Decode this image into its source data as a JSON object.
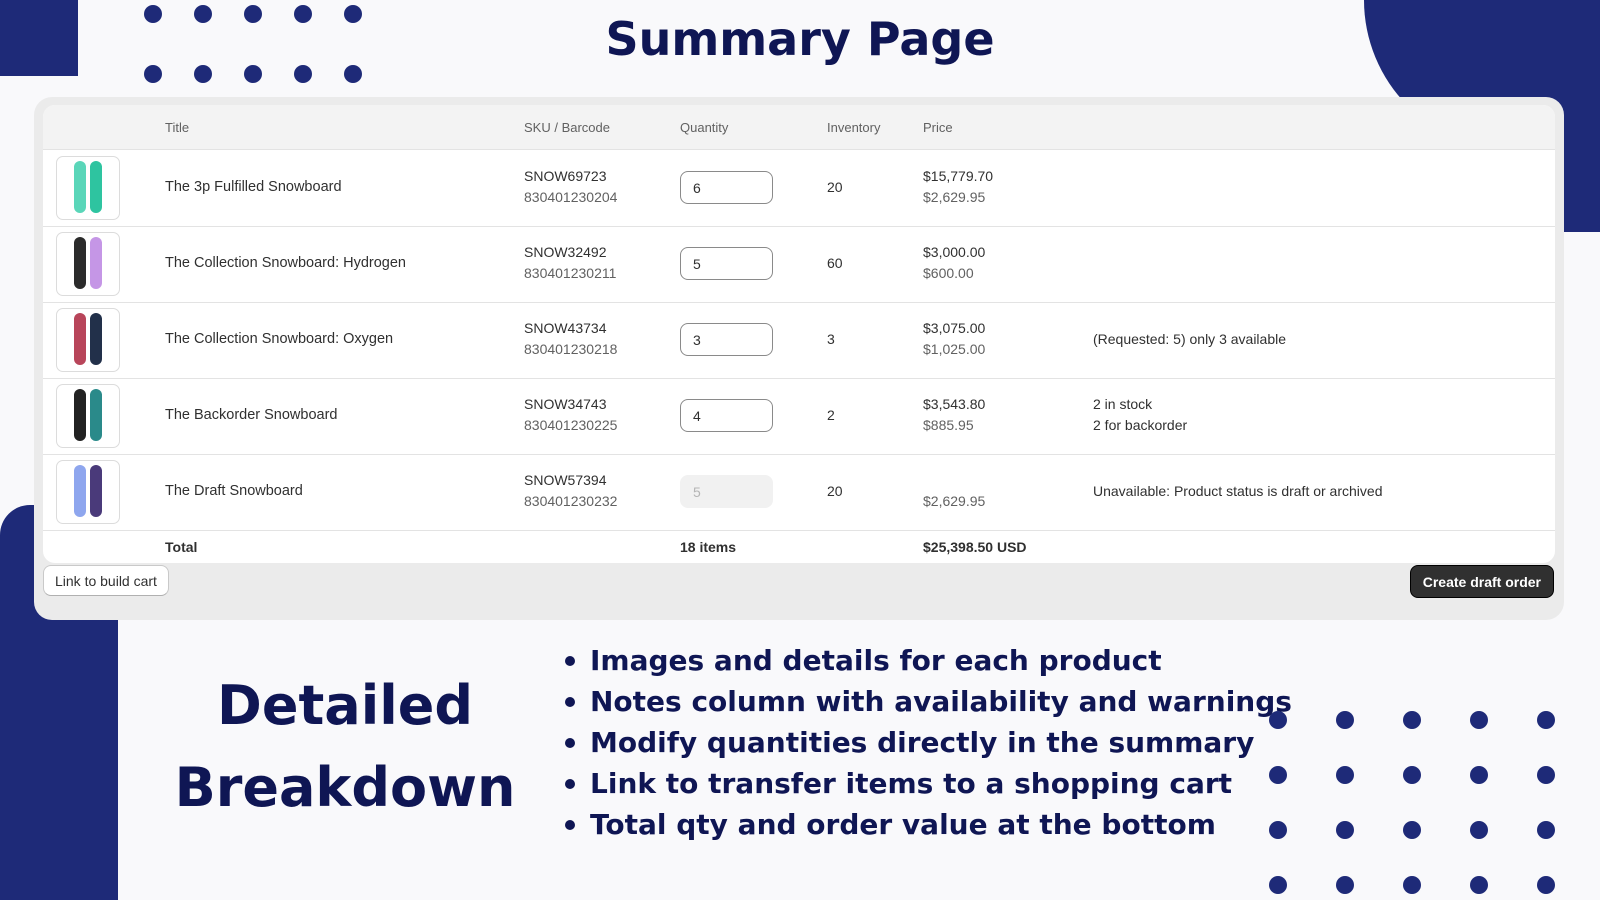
{
  "page_title": "Summary Page",
  "table": {
    "headers": {
      "title": "Title",
      "sku": "SKU / Barcode",
      "quantity": "Quantity",
      "inventory": "Inventory",
      "price": "Price"
    },
    "rows": [
      {
        "title": "The 3p Fulfilled Snowboard",
        "sku": "SNOW69723",
        "barcode": "830401230204",
        "quantity": "6",
        "inventory": "20",
        "price_total": "$15,779.70",
        "price_unit": "$2,629.95",
        "note_line1": "",
        "note_line2": "",
        "board_colors": [
          "#5ad6b9",
          "#2ec4a0"
        ]
      },
      {
        "title": "The Collection Snowboard: Hydrogen",
        "sku": "SNOW32492",
        "barcode": "830401230211",
        "quantity": "5",
        "inventory": "60",
        "price_total": "$3,000.00",
        "price_unit": "$600.00",
        "note_line1": "",
        "note_line2": "",
        "board_colors": [
          "#2b2b2b",
          "#c596e6"
        ]
      },
      {
        "title": "The Collection Snowboard: Oxygen",
        "sku": "SNOW43734",
        "barcode": "830401230218",
        "quantity": "3",
        "inventory": "3",
        "price_total": "$3,075.00",
        "price_unit": "$1,025.00",
        "note_line1": "(Requested: 5) only 3 available",
        "note_line2": "",
        "board_colors": [
          "#b8455a",
          "#22304a"
        ]
      },
      {
        "title": "The Backorder Snowboard",
        "sku": "SNOW34743",
        "barcode": "830401230225",
        "quantity": "4",
        "inventory": "2",
        "price_total": "$3,543.80",
        "price_unit": "$885.95",
        "note_line1": "2 in stock",
        "note_line2": "2 for backorder",
        "board_colors": [
          "#222222",
          "#2a8a8a"
        ]
      },
      {
        "title": "The Draft Snowboard",
        "sku": "SNOW57394",
        "barcode": "830401230232",
        "quantity": "5",
        "inventory": "20",
        "price_total": "",
        "price_unit": "$2,629.95",
        "note_line1": "Unavailable: Product status is draft or archived",
        "note_line2": "",
        "board_colors": [
          "#8ea6ee",
          "#4a3a7a"
        ],
        "disabled": true
      }
    ],
    "total": {
      "label": "Total",
      "items": "18 items",
      "value": "$25,398.50 USD"
    }
  },
  "buttons": {
    "link_to_cart": "Link to build cart",
    "create_draft": "Create draft order"
  },
  "feature_title_line1": "Detailed",
  "feature_title_line2": "Breakdown",
  "features": [
    "Images and details for each product",
    "Notes column with availability and warnings",
    "Modify quantities directly in the summary",
    "Link to transfer items to a shopping cart",
    "Total qty and order value at the bottom"
  ],
  "colors": {
    "brand_navy": "#1e2a78",
    "heading": "#0f1654",
    "primary_button": "#303030"
  }
}
